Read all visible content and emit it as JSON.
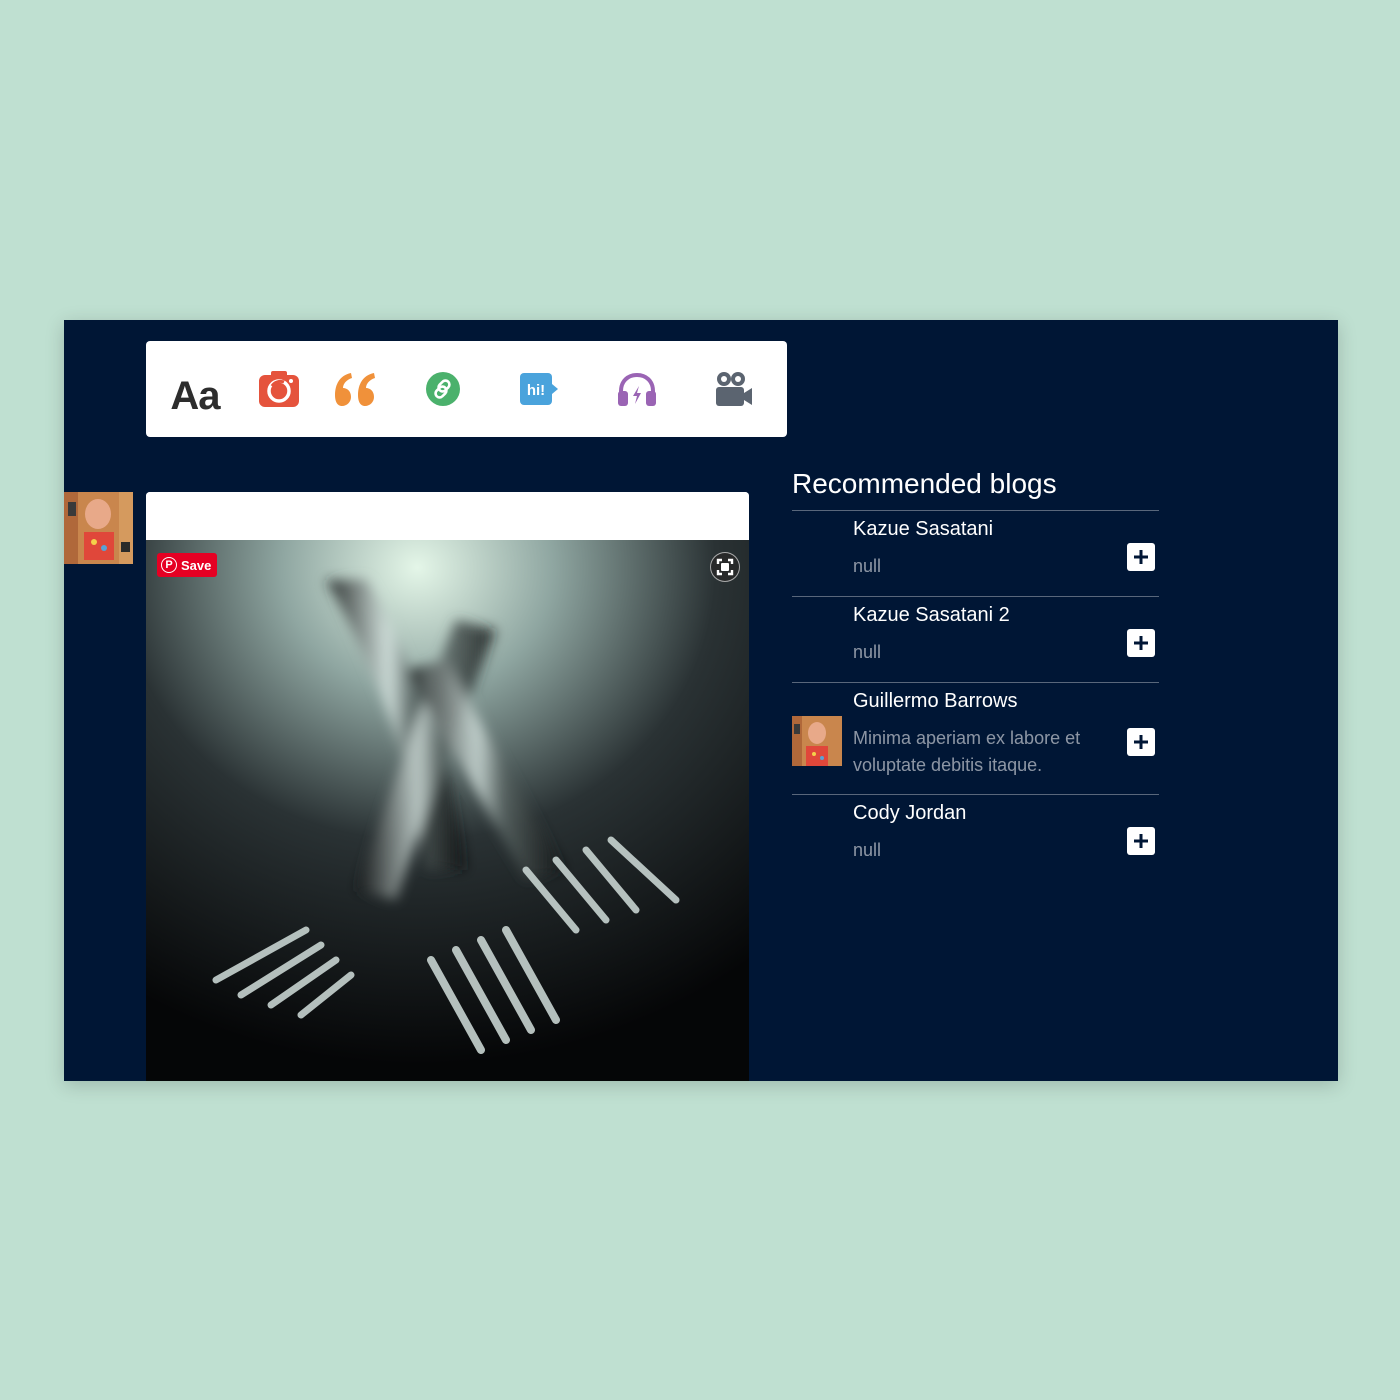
{
  "post_types": {
    "text_label": "Aa",
    "chat_label": "hi!",
    "colors": {
      "photo": "#e5533c",
      "quote": "#f0913a",
      "link": "#4bb16c",
      "chat": "#4aa3dc",
      "audio": "#9a64b4",
      "video": "#5b6470"
    }
  },
  "post": {
    "save_label": "Save"
  },
  "recommended": {
    "title": "Recommended blogs",
    "blogs": [
      {
        "name": "Kazue Sasatani",
        "description": "null",
        "has_avatar": false
      },
      {
        "name": "Kazue Sasatani 2",
        "description": "null",
        "has_avatar": false
      },
      {
        "name": "Guillermo Barrows",
        "description": "Minima aperiam ex labore et voluptate debitis itaque.",
        "has_avatar": true
      },
      {
        "name": "Cody Jordan",
        "description": "null",
        "has_avatar": false
      }
    ]
  },
  "icons": {
    "text": "text-icon",
    "photo": "camera-icon",
    "quote": "quote-icon",
    "link": "link-icon",
    "chat": "chat-icon",
    "audio": "headphones-icon",
    "video": "video-camera-icon",
    "pinterest": "pinterest-icon",
    "expand": "expand-icon",
    "follow": "plus-icon"
  }
}
